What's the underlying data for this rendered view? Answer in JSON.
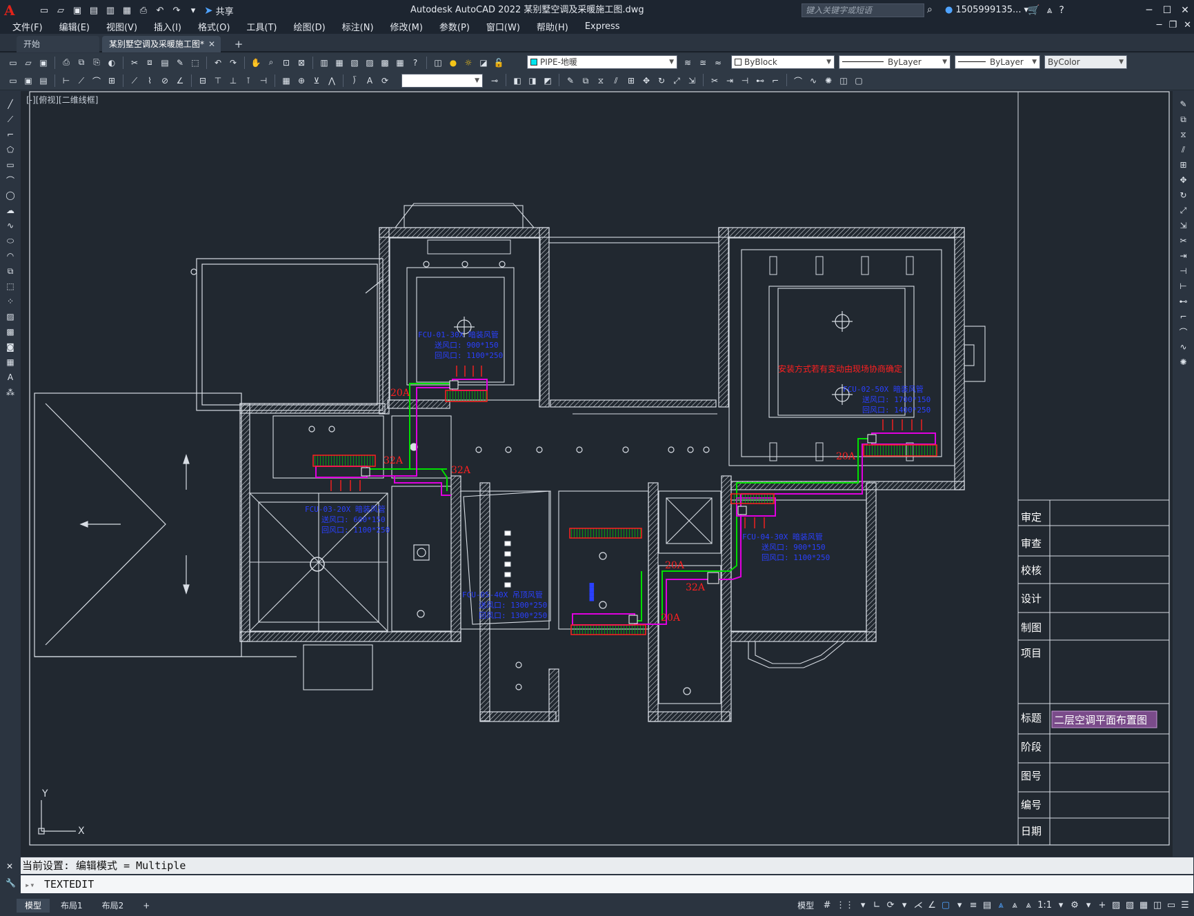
{
  "app": {
    "window_title": "Autodesk AutoCAD 2022    某别墅空调及采暖施工图.dwg",
    "share_label": "共享",
    "search_placeholder": "键入关键字或短语",
    "user_name": "1505999135...",
    "colors": {
      "accent": "#4fa3ff",
      "bg": "#212830",
      "chrome": "#2b3440"
    }
  },
  "menu": [
    "文件(F)",
    "编辑(E)",
    "视图(V)",
    "插入(I)",
    "格式(O)",
    "工具(T)",
    "绘图(D)",
    "标注(N)",
    "修改(M)",
    "参数(P)",
    "窗口(W)",
    "帮助(H)",
    "Express"
  ],
  "tabs": {
    "home": "开始",
    "doc": "某别墅空调及采暖施工图*"
  },
  "toolbar": {
    "layer": "PIPE-地暖",
    "color": "ByBlock",
    "linetype": "ByLayer",
    "lineweight": "ByLayer",
    "plotstyle": "ByColor",
    "text_style": ""
  },
  "viewport": {
    "label": "[-][俯视][二维线框]"
  },
  "drawing": {
    "title_block_labels": [
      "审定",
      "审查",
      "校核",
      "设计",
      "制图",
      "项目",
      "标题",
      "阶段",
      "图号",
      "编号",
      "日期"
    ],
    "drawing_title": "二层空调平面布置图",
    "note_red": "安装方式若有变动由现场协商确定",
    "pipe_labels": [
      "20A",
      "32A",
      "32A",
      "20A",
      "20A",
      "20A",
      "32A",
      "20A"
    ],
    "units": [
      {
        "model": "FCU-01-30X 暗装风管",
        "supply": "送风口: 900*150",
        "return": "回风口: 1100*250"
      },
      {
        "model": "FCU-02-50X 暗装风管",
        "supply": "送风口: 1700*150",
        "return": "回风口: 1400*250"
      },
      {
        "model": "FCU-03-20X 暗装风管",
        "supply": "送风口: 600*150",
        "return": "回风口: 1100*250"
      },
      {
        "model": "FCU-04-30X 暗装风管",
        "supply": "送风口: 900*150",
        "return": "回风口: 1100*250"
      },
      {
        "model": "FCU-05-40X 吊顶风管",
        "supply": "送风口: 1300*250",
        "return": "回风口: 1300*250"
      }
    ],
    "ucs": {
      "x": "X",
      "y": "Y"
    }
  },
  "command": {
    "history": "当前设置: 编辑模式 = Multiple",
    "current": "TEXTEDIT"
  },
  "status": {
    "layout_tabs": [
      "模型",
      "布局1",
      "布局2"
    ],
    "model_label": "模型",
    "scale": "1:1"
  }
}
